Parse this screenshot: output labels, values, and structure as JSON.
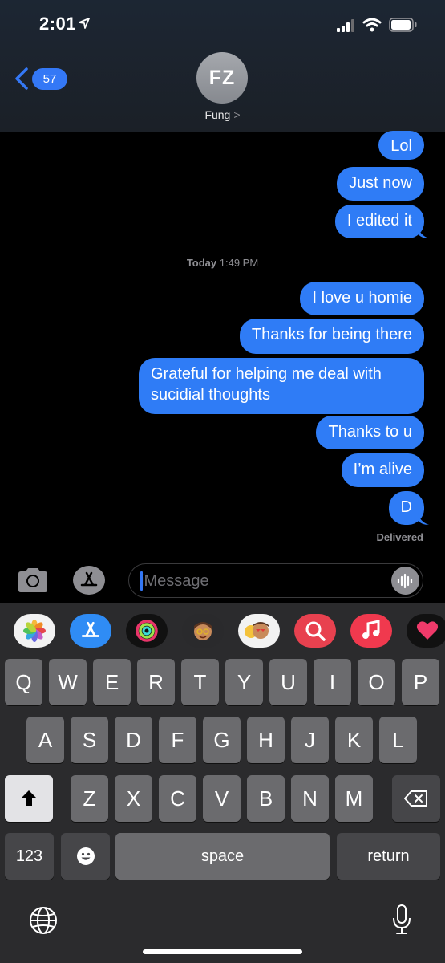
{
  "status": {
    "time": "2:01"
  },
  "nav": {
    "back_count": "57",
    "avatar_initials": "FZ",
    "contact_name": "Fung",
    "contact_chevron": ">"
  },
  "messages": [
    {
      "text": "Lol"
    },
    {
      "text": "Just now"
    },
    {
      "text": "I edited it"
    },
    {
      "text": "I love u homie"
    },
    {
      "text": "Thanks for being there"
    },
    {
      "text": "Grateful for helping me deal with sucidial thoughts"
    },
    {
      "text": "Thanks to u"
    },
    {
      "text": "I’m alive"
    },
    {
      "text": "D"
    }
  ],
  "timestamp": {
    "label": "Today",
    "time": "1:49 PM"
  },
  "delivered": "Delivered",
  "composer": {
    "placeholder": "iMessage"
  },
  "app_tray": [
    "photos-icon",
    "app-store-icon",
    "activity-icon",
    "memoji-icon",
    "memoji-stickers-icon",
    "search-images-icon",
    "music-icon",
    "heart-digital-touch-icon"
  ],
  "keyboard": {
    "row1": [
      "Q",
      "W",
      "E",
      "R",
      "T",
      "Y",
      "U",
      "I",
      "O",
      "P"
    ],
    "row2": [
      "A",
      "S",
      "D",
      "F",
      "G",
      "H",
      "J",
      "K",
      "L"
    ],
    "row3": [
      "Z",
      "X",
      "C",
      "V",
      "B",
      "N",
      "M"
    ],
    "numbers": "123",
    "space": "space",
    "return": "return"
  },
  "colors": {
    "bubble": "#2f7cf6",
    "accent": "#3478f6"
  }
}
